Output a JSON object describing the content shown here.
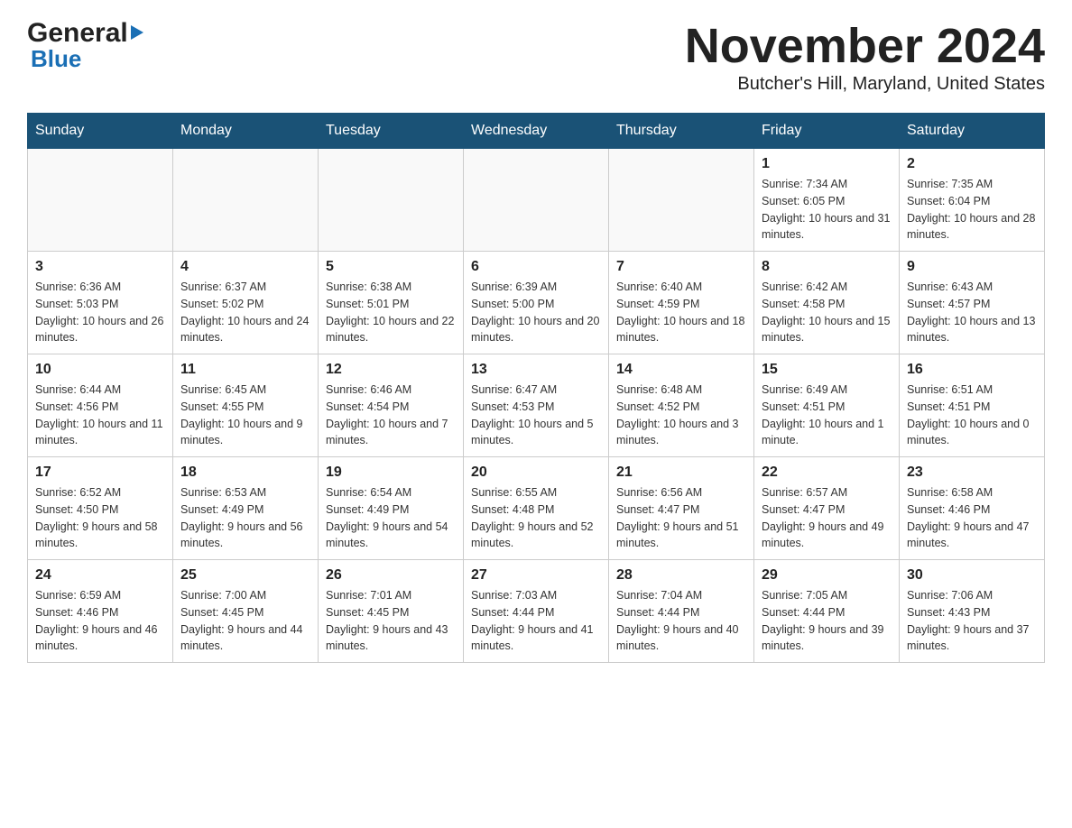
{
  "header": {
    "logo_general": "General",
    "logo_blue": "Blue",
    "month_title": "November 2024",
    "location": "Butcher's Hill, Maryland, United States"
  },
  "days_of_week": [
    "Sunday",
    "Monday",
    "Tuesday",
    "Wednesday",
    "Thursday",
    "Friday",
    "Saturday"
  ],
  "weeks": [
    [
      {
        "day": "",
        "info": ""
      },
      {
        "day": "",
        "info": ""
      },
      {
        "day": "",
        "info": ""
      },
      {
        "day": "",
        "info": ""
      },
      {
        "day": "",
        "info": ""
      },
      {
        "day": "1",
        "info": "Sunrise: 7:34 AM\nSunset: 6:05 PM\nDaylight: 10 hours and 31 minutes."
      },
      {
        "day": "2",
        "info": "Sunrise: 7:35 AM\nSunset: 6:04 PM\nDaylight: 10 hours and 28 minutes."
      }
    ],
    [
      {
        "day": "3",
        "info": "Sunrise: 6:36 AM\nSunset: 5:03 PM\nDaylight: 10 hours and 26 minutes."
      },
      {
        "day": "4",
        "info": "Sunrise: 6:37 AM\nSunset: 5:02 PM\nDaylight: 10 hours and 24 minutes."
      },
      {
        "day": "5",
        "info": "Sunrise: 6:38 AM\nSunset: 5:01 PM\nDaylight: 10 hours and 22 minutes."
      },
      {
        "day": "6",
        "info": "Sunrise: 6:39 AM\nSunset: 5:00 PM\nDaylight: 10 hours and 20 minutes."
      },
      {
        "day": "7",
        "info": "Sunrise: 6:40 AM\nSunset: 4:59 PM\nDaylight: 10 hours and 18 minutes."
      },
      {
        "day": "8",
        "info": "Sunrise: 6:42 AM\nSunset: 4:58 PM\nDaylight: 10 hours and 15 minutes."
      },
      {
        "day": "9",
        "info": "Sunrise: 6:43 AM\nSunset: 4:57 PM\nDaylight: 10 hours and 13 minutes."
      }
    ],
    [
      {
        "day": "10",
        "info": "Sunrise: 6:44 AM\nSunset: 4:56 PM\nDaylight: 10 hours and 11 minutes."
      },
      {
        "day": "11",
        "info": "Sunrise: 6:45 AM\nSunset: 4:55 PM\nDaylight: 10 hours and 9 minutes."
      },
      {
        "day": "12",
        "info": "Sunrise: 6:46 AM\nSunset: 4:54 PM\nDaylight: 10 hours and 7 minutes."
      },
      {
        "day": "13",
        "info": "Sunrise: 6:47 AM\nSunset: 4:53 PM\nDaylight: 10 hours and 5 minutes."
      },
      {
        "day": "14",
        "info": "Sunrise: 6:48 AM\nSunset: 4:52 PM\nDaylight: 10 hours and 3 minutes."
      },
      {
        "day": "15",
        "info": "Sunrise: 6:49 AM\nSunset: 4:51 PM\nDaylight: 10 hours and 1 minute."
      },
      {
        "day": "16",
        "info": "Sunrise: 6:51 AM\nSunset: 4:51 PM\nDaylight: 10 hours and 0 minutes."
      }
    ],
    [
      {
        "day": "17",
        "info": "Sunrise: 6:52 AM\nSunset: 4:50 PM\nDaylight: 9 hours and 58 minutes."
      },
      {
        "day": "18",
        "info": "Sunrise: 6:53 AM\nSunset: 4:49 PM\nDaylight: 9 hours and 56 minutes."
      },
      {
        "day": "19",
        "info": "Sunrise: 6:54 AM\nSunset: 4:49 PM\nDaylight: 9 hours and 54 minutes."
      },
      {
        "day": "20",
        "info": "Sunrise: 6:55 AM\nSunset: 4:48 PM\nDaylight: 9 hours and 52 minutes."
      },
      {
        "day": "21",
        "info": "Sunrise: 6:56 AM\nSunset: 4:47 PM\nDaylight: 9 hours and 51 minutes."
      },
      {
        "day": "22",
        "info": "Sunrise: 6:57 AM\nSunset: 4:47 PM\nDaylight: 9 hours and 49 minutes."
      },
      {
        "day": "23",
        "info": "Sunrise: 6:58 AM\nSunset: 4:46 PM\nDaylight: 9 hours and 47 minutes."
      }
    ],
    [
      {
        "day": "24",
        "info": "Sunrise: 6:59 AM\nSunset: 4:46 PM\nDaylight: 9 hours and 46 minutes."
      },
      {
        "day": "25",
        "info": "Sunrise: 7:00 AM\nSunset: 4:45 PM\nDaylight: 9 hours and 44 minutes."
      },
      {
        "day": "26",
        "info": "Sunrise: 7:01 AM\nSunset: 4:45 PM\nDaylight: 9 hours and 43 minutes."
      },
      {
        "day": "27",
        "info": "Sunrise: 7:03 AM\nSunset: 4:44 PM\nDaylight: 9 hours and 41 minutes."
      },
      {
        "day": "28",
        "info": "Sunrise: 7:04 AM\nSunset: 4:44 PM\nDaylight: 9 hours and 40 minutes."
      },
      {
        "day": "29",
        "info": "Sunrise: 7:05 AM\nSunset: 4:44 PM\nDaylight: 9 hours and 39 minutes."
      },
      {
        "day": "30",
        "info": "Sunrise: 7:06 AM\nSunset: 4:43 PM\nDaylight: 9 hours and 37 minutes."
      }
    ]
  ]
}
